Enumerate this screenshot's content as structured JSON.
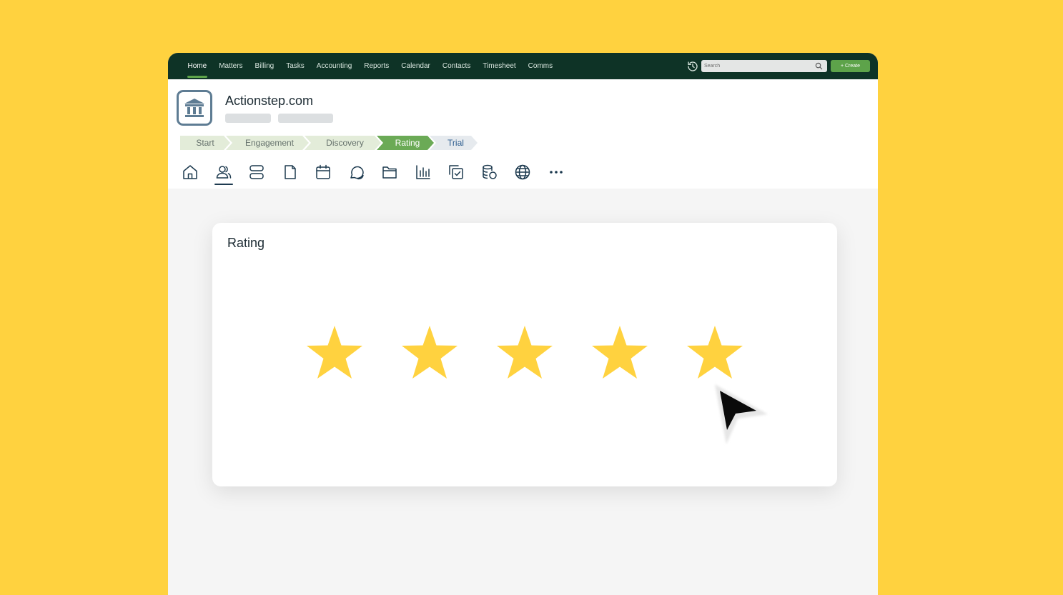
{
  "nav": {
    "items": [
      "Home",
      "Matters",
      "Billing",
      "Tasks",
      "Accounting",
      "Reports",
      "Calendar",
      "Contacts",
      "Timesheet",
      "Comms"
    ],
    "active_index": 0,
    "search_placeholder": "Search",
    "create_label": "+ Create"
  },
  "header": {
    "title": "Actionstep.com",
    "logo_icon": "bank-icon",
    "stages": [
      {
        "label": "Start",
        "state": "done"
      },
      {
        "label": "Engagement",
        "state": "done"
      },
      {
        "label": "Discovery",
        "state": "done"
      },
      {
        "label": "Rating",
        "state": "current"
      },
      {
        "label": "Trial",
        "state": "future"
      }
    ],
    "tab_icons": [
      "home-icon",
      "contacts-icon",
      "layers-icon",
      "document-icon",
      "calendar-icon",
      "chat-icon",
      "folder-icon",
      "chart-icon",
      "tasks-icon",
      "billing-icon",
      "globe-icon",
      "more-icon"
    ],
    "active_tab_index": 1
  },
  "rating": {
    "title": "Rating",
    "max_stars": 5,
    "value": 5,
    "star_color": "#FFD23F"
  },
  "colors": {
    "page_background": "#FFD23F",
    "nav_background": "#0E3326",
    "accent_green": "#5DA34A"
  }
}
